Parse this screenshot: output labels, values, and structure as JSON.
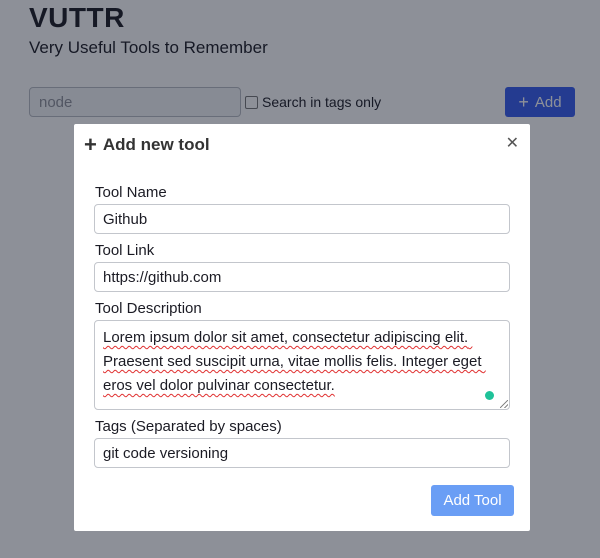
{
  "app": {
    "title": "VUTTR",
    "subtitle": "Very Useful Tools to Remember"
  },
  "toolbar": {
    "search_placeholder": "node",
    "search_value": "",
    "tags_only_label": "Search in tags only",
    "tags_only_checked": false,
    "add_label": "Add",
    "add_icon": "plus-icon",
    "accent_color": "#365df0"
  },
  "modal": {
    "title": "Add new tool",
    "title_icon": "plus-icon",
    "close_icon": "close-icon",
    "fields": {
      "name": {
        "label": "Tool Name",
        "value": "Github"
      },
      "link": {
        "label": "Tool Link",
        "value": "https://github.com"
      },
      "description": {
        "label": "Tool Description",
        "value": "Lorem ipsum dolor sit amet, consectetur adipiscing elit. Praesent sed suscipit urna, vitae mollis felis. Integer eget eros vel dolor pulvinar consectetur."
      },
      "tags": {
        "label": "Tags (Separated by spaces)",
        "value": "git code versioning"
      }
    },
    "submit_label": "Add Tool",
    "submit_color": "#6a9ef5"
  }
}
